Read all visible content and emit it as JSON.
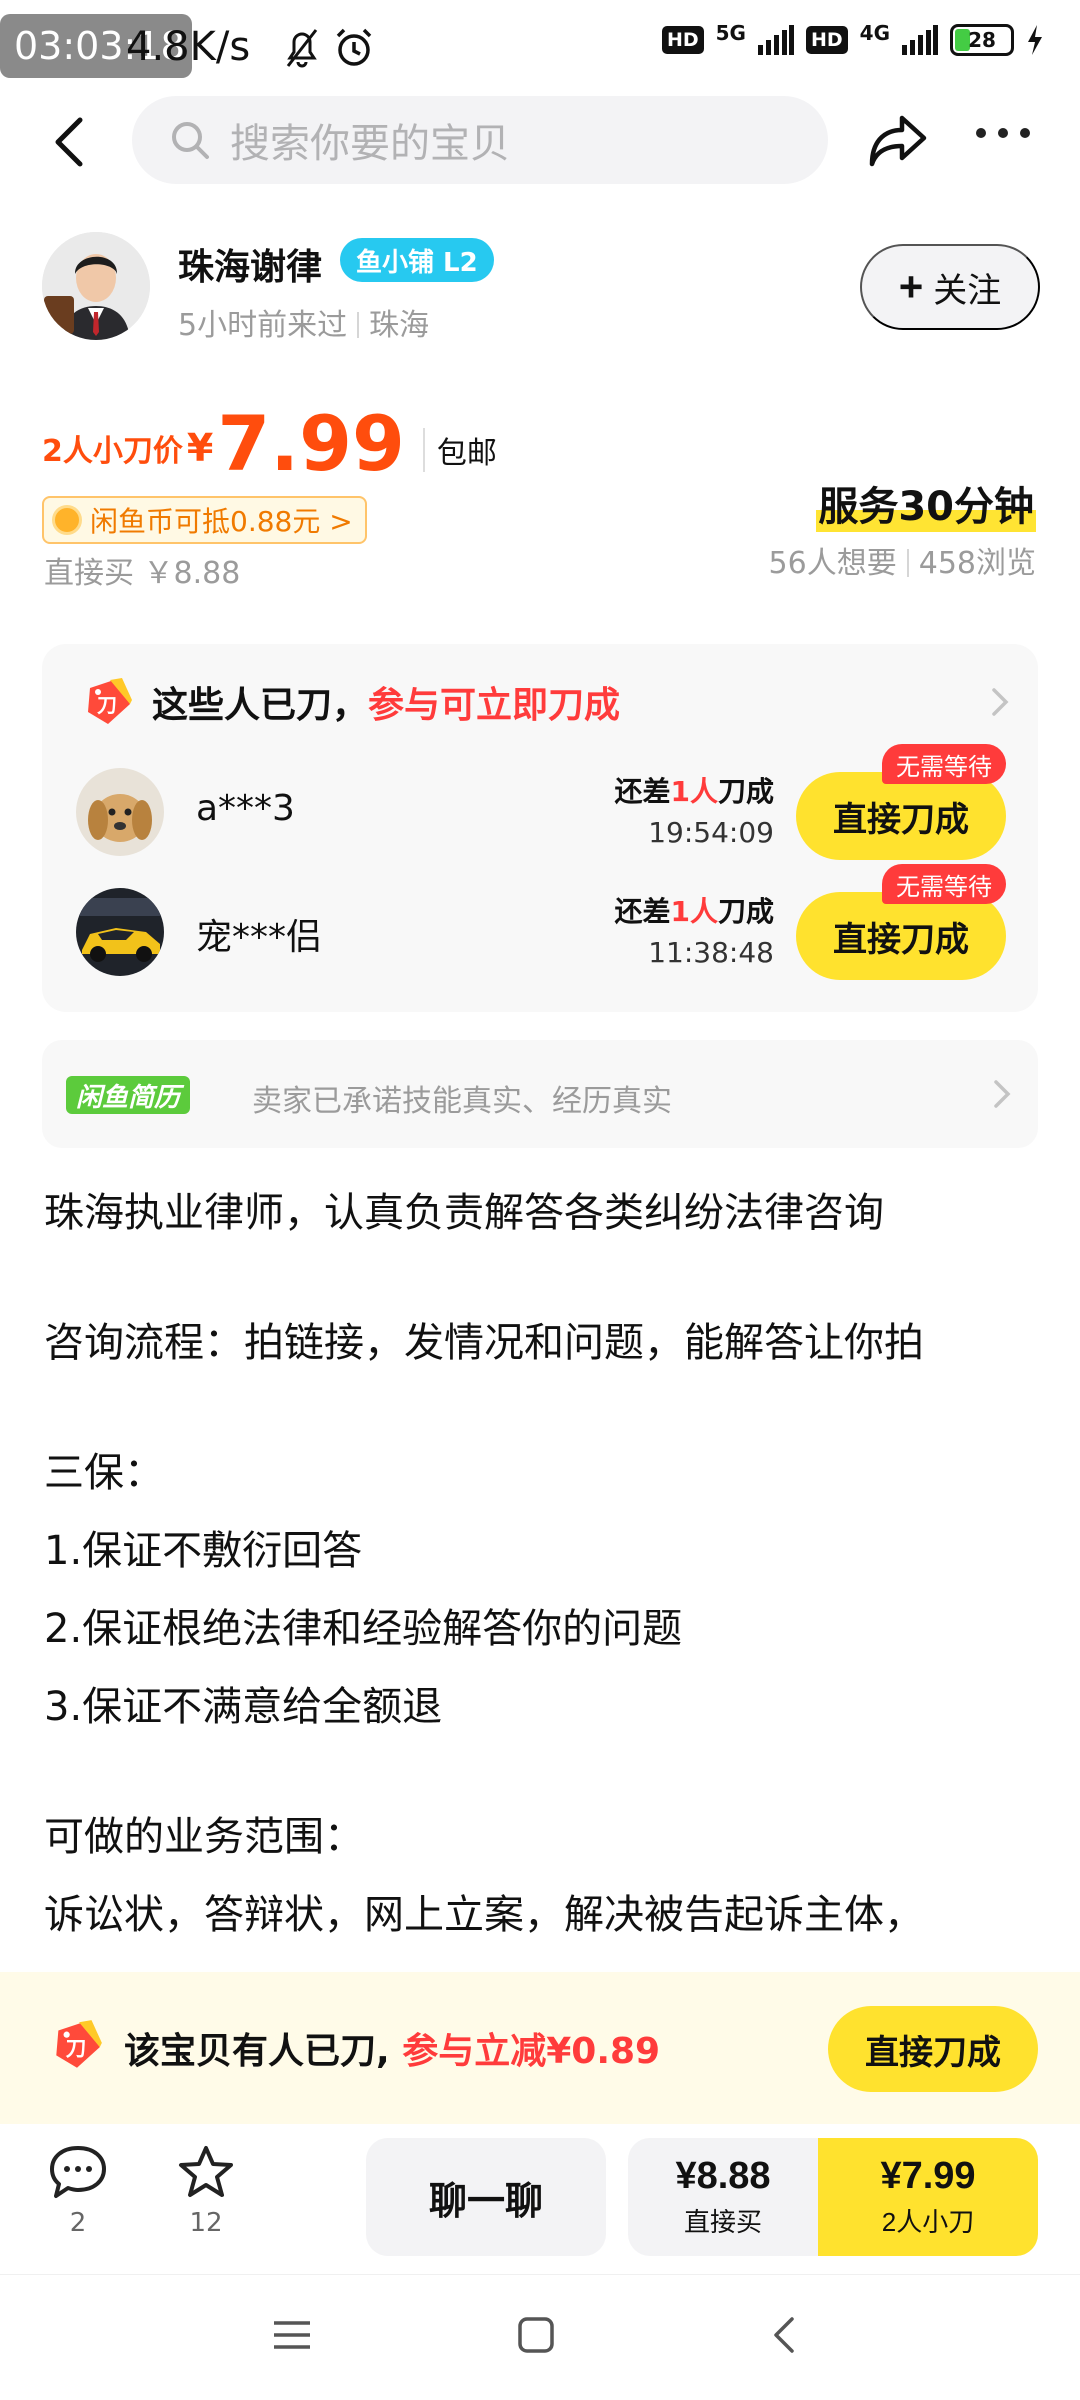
{
  "status_bar": {
    "time": "03:03:18",
    "speed": "4.8K/s",
    "network_1": "5G",
    "network_2": "4G",
    "hd": "HD",
    "battery": "28"
  },
  "nav": {
    "search_placeholder": "搜索你要的宝贝"
  },
  "seller": {
    "name": "珠海谢律",
    "badge": "鱼小铺 L2",
    "last_seen": "5小时前来过",
    "location": "珠海",
    "follow_plus": "+",
    "follow_label": "关注"
  },
  "price": {
    "label": "2人小刀价",
    "currency": "¥",
    "value": "7.99",
    "shipping": "包邮",
    "coin_offset": "闲鱼币可抵0.88元 >",
    "direct_buy": "直接买 ￥8.88",
    "service_time": "服务30分钟",
    "wants": "56人想要",
    "views": "458浏览"
  },
  "bargain": {
    "title_part1": "这些人已刀，",
    "title_part2": "参与可立即刀成",
    "icon_text": "刀",
    "rows": [
      {
        "name": "a***3",
        "need_prefix": "还差",
        "need_count": "1人",
        "need_suffix": "刀成",
        "countdown": "19:54:09",
        "button": "直接刀成",
        "badge": "无需等待"
      },
      {
        "name": "宠***侣",
        "need_prefix": "还差",
        "need_count": "1人",
        "need_suffix": "刀成",
        "countdown": "11:38:48",
        "button": "直接刀成",
        "badge": "无需等待"
      }
    ]
  },
  "resume": {
    "logo": "闲鱼简历",
    "text": "卖家已承诺技能真实、经历真实"
  },
  "description": {
    "lines": [
      "珠海执业律师，认真负责解答各类纠纷法律咨询",
      "咨询流程：拍链接，发情况和问题，能解答让你拍",
      "三保：",
      "1.保证不敷衍回答",
      "2.保证根绝法律和经验解答你的问题",
      "3.保证不满意给全额退",
      "可做的业务范围：",
      "诉讼状，答辩状，网上立案，解决被告起诉主体，"
    ]
  },
  "banner": {
    "icon_text": "刀",
    "text_part1": "该宝贝有人已刀,",
    "text_part2": "参与立减¥0.89",
    "button": "直接刀成"
  },
  "action_bar": {
    "comments_count": "2",
    "favorites_count": "12",
    "chat": "聊一聊",
    "direct_price": "¥8.88",
    "direct_label": "直接买",
    "bargain_price": "¥7.99",
    "bargain_label": "2人小刀"
  },
  "colors": {
    "accent_yellow": "#ffe22e",
    "price_orange": "#ff4d0d",
    "highlight_red": "#ff3b3b",
    "shop_badge_blue": "#27c9f0"
  }
}
